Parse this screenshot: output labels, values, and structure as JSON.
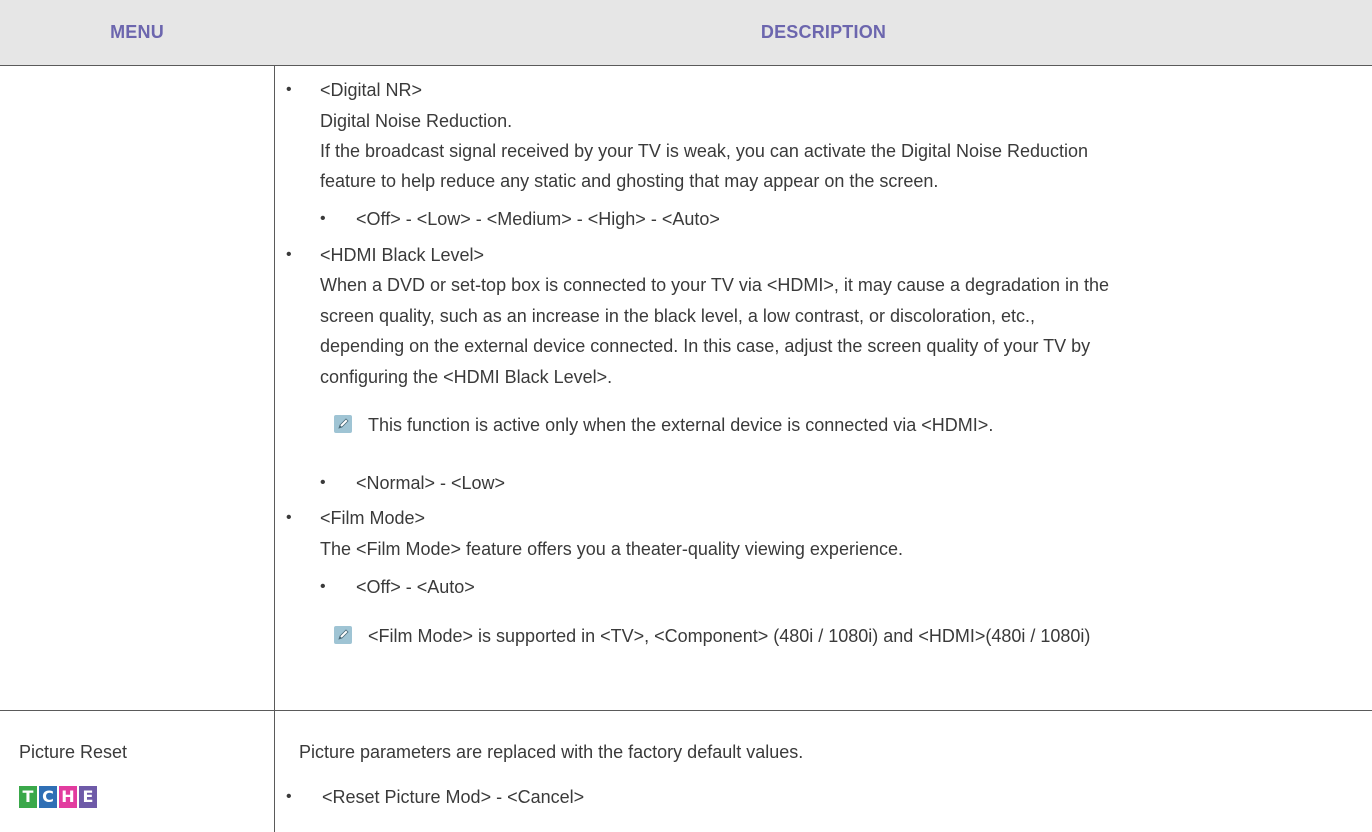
{
  "header": {
    "menu": "MENU",
    "description": "DESCRIPTION"
  },
  "digital_nr": {
    "title": "<Digital NR>",
    "subtitle": "Digital Noise Reduction.",
    "desc_line1": "If the broadcast signal received by your TV is weak, you can activate the Digital Noise Reduction",
    "desc_line2": "feature to help reduce any static and ghosting that may appear on the screen.",
    "options": "<Off> - <Low> - <Medium> - <High> - <Auto>"
  },
  "hdmi_black_level": {
    "title": "<HDMI Black Level>",
    "desc_line1": "When a DVD or set-top box is connected to your TV via <HDMI>, it may cause a degradation in the",
    "desc_line2": "screen quality, such as an increase in the black level, a low contrast, or discoloration, etc.,",
    "desc_line3": "depending on the external device connected. In this case, adjust the screen quality of your TV by",
    "desc_line4": "configuring the <HDMI Black Level>.",
    "note": "This function is active only when the external device is connected via <HDMI>.",
    "options": "<Normal> - <Low>"
  },
  "film_mode": {
    "title": "<Film Mode>",
    "desc": "The <Film Mode> feature offers you a theater-quality viewing experience.",
    "options": "<Off> - <Auto>",
    "note": "<Film Mode> is supported in <TV>, <Component> (480i / 1080i) and <HDMI>(480i / 1080i)"
  },
  "picture_reset": {
    "menu_label": "Picture Reset",
    "badges": [
      {
        "letter": "T",
        "color": "#3aa84a"
      },
      {
        "letter": "C",
        "color": "#2f6fb5"
      },
      {
        "letter": "H",
        "color": "#e23c9f"
      },
      {
        "letter": "E",
        "color": "#6e5aa8"
      }
    ],
    "desc": "Picture parameters are replaced with the factory default values.",
    "options": "<Reset Picture Mod> - <Cancel>"
  },
  "bullet": "•",
  "colors": {
    "header_text": "#6c66ae",
    "header_bg": "#e6e6e6",
    "note_icon": "#9fc4d4"
  }
}
